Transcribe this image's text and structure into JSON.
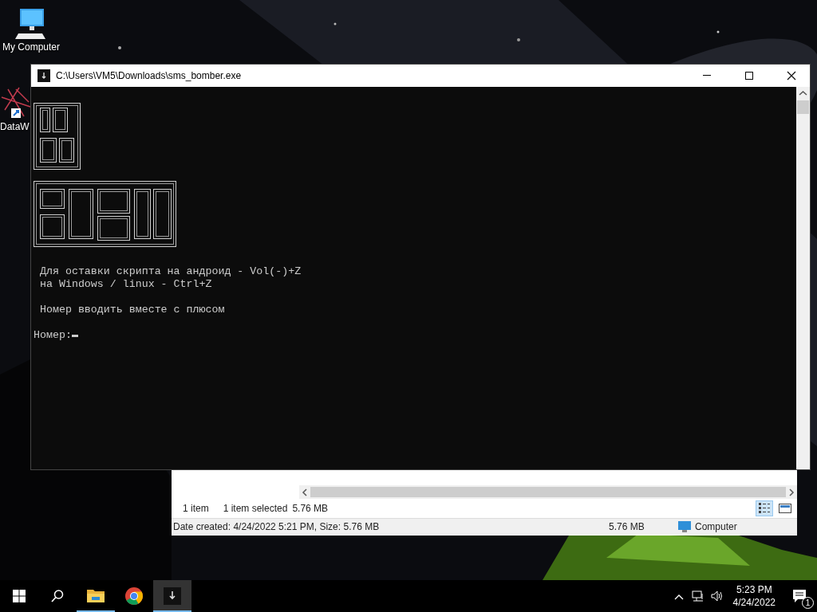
{
  "desktop": {
    "icons": [
      {
        "kind": "computer",
        "label": "My Computer"
      },
      {
        "kind": "shortcut",
        "label": "DataW"
      }
    ]
  },
  "console": {
    "title": "C:\\Users\\VM5\\Downloads\\sms_bomber.exe",
    "paragraphs": [
      {
        "lines": [
          "Для оставки скрипта на андроид - Vol(-)+Z",
          "на Windows / linux - Ctrl+Z"
        ]
      },
      {
        "lines": [
          "Номер вводить вместе с плюсом"
        ]
      }
    ],
    "prompt": "Номер:"
  },
  "explorer": {
    "status_items": [
      "1 item",
      "1 item selected",
      "5.76 MB"
    ],
    "views": [
      {
        "kind": "details",
        "selected": true
      },
      {
        "kind": "preview",
        "selected": false
      }
    ],
    "details_bar": {
      "info": "Date created: 4/24/2022 5:21 PM, Size: 5.76 MB",
      "size": "5.76 MB",
      "location": "Computer"
    }
  },
  "taskbar": {
    "apps": [
      {
        "kind": "folder",
        "running": true,
        "selected": false
      },
      {
        "kind": "chrome",
        "running": false,
        "selected": false
      },
      {
        "kind": "console",
        "running": true,
        "selected": true
      }
    ],
    "clock": {
      "time": "5:23 PM",
      "date": "4/24/2022"
    },
    "notifications": "1"
  }
}
